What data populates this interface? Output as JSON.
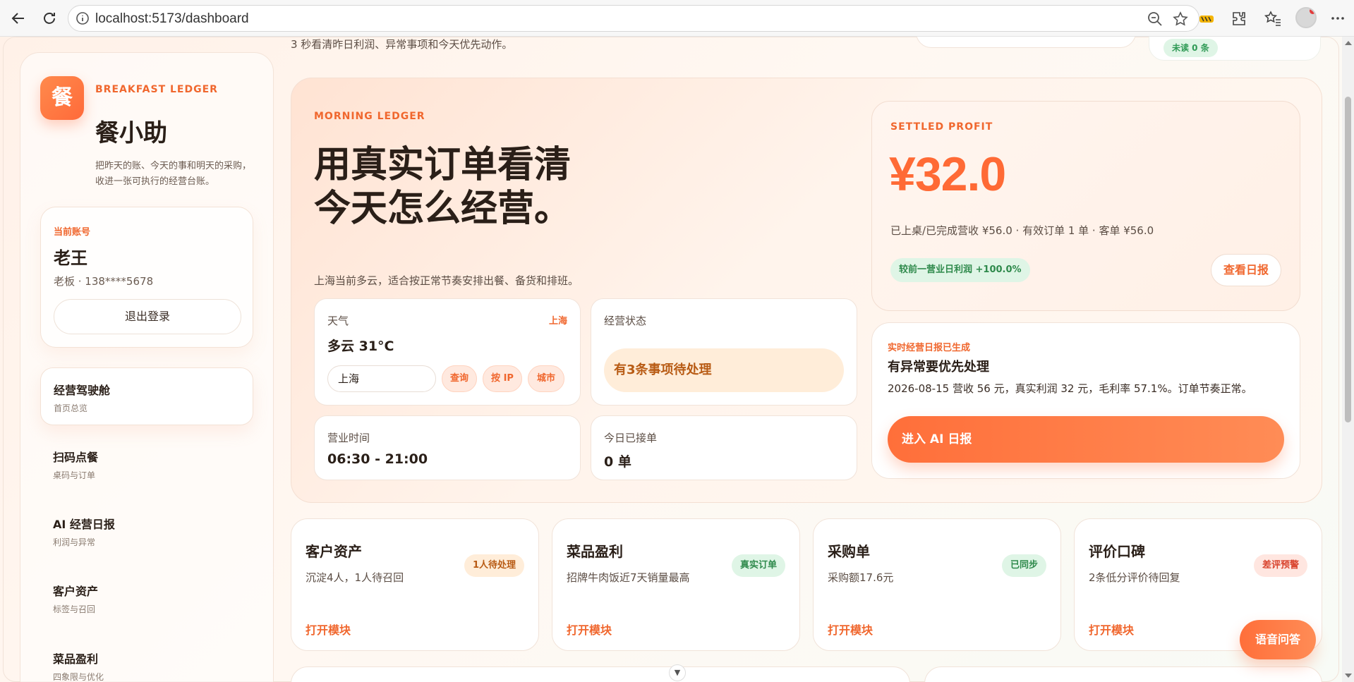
{
  "browser": {
    "url": "localhost:5173/dashboard"
  },
  "sidebar": {
    "brand_icon": "餐",
    "brand_eyebrow": "BREAKFAST LEDGER",
    "brand_title": "餐小助",
    "brand_desc": "把昨天的账、今天的事和明天的采购，收进一张可执行的经营台账。",
    "account": {
      "label": "当前账号",
      "name": "老王",
      "meta": "老板 · 138****5678",
      "logout_label": "退出登录"
    },
    "items": [
      {
        "title": "经营驾驶舱",
        "sub": "首页总览"
      },
      {
        "title": "扫码点餐",
        "sub": "桌码与订单"
      },
      {
        "title": "AI 经营日报",
        "sub": "利润与异常"
      },
      {
        "title": "客户资产",
        "sub": "标签与召回"
      },
      {
        "title": "菜品盈利",
        "sub": "四象限与优化"
      }
    ]
  },
  "top": {
    "subtitle": "3 秒看清昨日利润、异常事项和今天优先动作。",
    "pill": "未读 0 条"
  },
  "hero": {
    "eyebrow": "MORNING LEDGER",
    "title": "用真实订单看清今天怎么经营。",
    "desc": "上海当前多云，适合按正常节奏安排出餐、备货和排班。",
    "weather": {
      "label": "天气",
      "city": "上海",
      "value": "多云 31°C",
      "input_value": "上海",
      "buttons": [
        "查询",
        "按 IP",
        "城市"
      ]
    },
    "status": {
      "label": "经营状态",
      "value": "有3条事项待处理"
    },
    "hours": {
      "label": "营业时间",
      "value": "06:30 - 21:00"
    },
    "orders": {
      "label": "今日已接单",
      "value": "0 单"
    },
    "profit": {
      "eyebrow": "SETTLED PROFIT",
      "amount": "¥32.0",
      "detail": "已上桌/已完成营收 ¥56.0 · 有效订单 1 单 · 客单 ¥56.0",
      "compare": "较前一营业日利润 +100.0%",
      "report_button": "查看日报"
    },
    "ai": {
      "eyebrow": "实时经营日报已生成",
      "title": "有异常要优先处理",
      "desc": "2026-08-15 营收 56 元，真实利润 32 元，毛利率 57.1%。订单节奏正常。",
      "cta": "进入 AI 日报"
    }
  },
  "modules": [
    {
      "title": "客户资产",
      "desc": "沉淀4人，1人待召回",
      "badge": "1人待处理",
      "link": "打开模块"
    },
    {
      "title": "菜品盈利",
      "desc": "招牌牛肉饭近7天销量最高",
      "badge": "真实订单",
      "link": "打开模块"
    },
    {
      "title": "采购单",
      "desc": "采购额17.6元",
      "badge": "已同步",
      "link": "打开模块"
    },
    {
      "title": "评价口碑",
      "desc": "2条低分评价待回复",
      "badge": "差评预警",
      "link": "打开模块"
    }
  ],
  "voice_button": "语音问答",
  "colors": {
    "accent": "#f0672e",
    "profit": "#ff6a35",
    "success_bg": "#dff5e6",
    "warning_bg": "#ffedd9"
  }
}
